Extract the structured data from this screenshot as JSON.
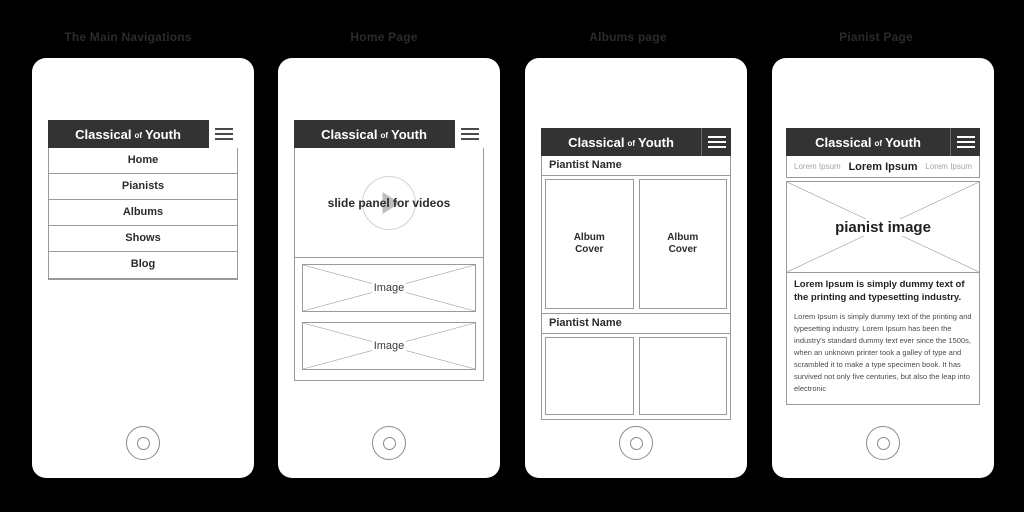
{
  "brand": {
    "name_part1": "Classical",
    "name_connector": "of",
    "name_part2": "Youth",
    "menu_icon": "hamburger-icon"
  },
  "colors": {
    "page_background": "#000000",
    "phone_body": "#ffffff",
    "appbar": "#333333",
    "title_text": "#2b2b2b",
    "border": "#9a9a9a",
    "muted_text": "#a4a4a4"
  },
  "screens": [
    {
      "title": "The Main Navigations",
      "nav_items": [
        {
          "label": "Home"
        },
        {
          "label": "Pianists"
        },
        {
          "label": "Albums"
        },
        {
          "label": "Shows"
        },
        {
          "label": "Blog"
        }
      ]
    },
    {
      "title": "Home Page",
      "slider": {
        "label": "slide panel for videos",
        "play_icon": "play-icon"
      },
      "images": [
        {
          "caption": "Image"
        },
        {
          "caption": "Image"
        }
      ]
    },
    {
      "title": "Albums page",
      "sections": [
        {
          "heading": "Piantist Name",
          "albums": [
            {
              "line1": "Album",
              "line2": "Cover"
            },
            {
              "line1": "Album",
              "line2": "Cover"
            }
          ]
        },
        {
          "heading": "Piantist Name",
          "albums": [
            {
              "line1": "",
              "line2": ""
            },
            {
              "line1": "",
              "line2": ""
            }
          ]
        }
      ]
    },
    {
      "title": "Pianist Page",
      "breadcrumbs": [
        {
          "label": "Lorem Ipsum",
          "active": false
        },
        {
          "label": "Lorem Ipsum",
          "active": true
        },
        {
          "label": "Lorem Ipsum",
          "active": false
        }
      ],
      "hero": {
        "caption": "pianist image"
      },
      "article": {
        "heading": "Lorem Ipsum is simply dummy text of the printing and typesetting industry.",
        "body": "Lorem Ipsum is simply dummy text of the printing and typesetting industry. Lorem Ipsum has been the industry's standard dummy text ever since the 1500s, when an unknown printer took a galley of type and scrambled it to make a type specimen book. It has survived not only five centuries, but also the leap into electronic"
      }
    }
  ],
  "home_button": {
    "name": "home-button"
  }
}
